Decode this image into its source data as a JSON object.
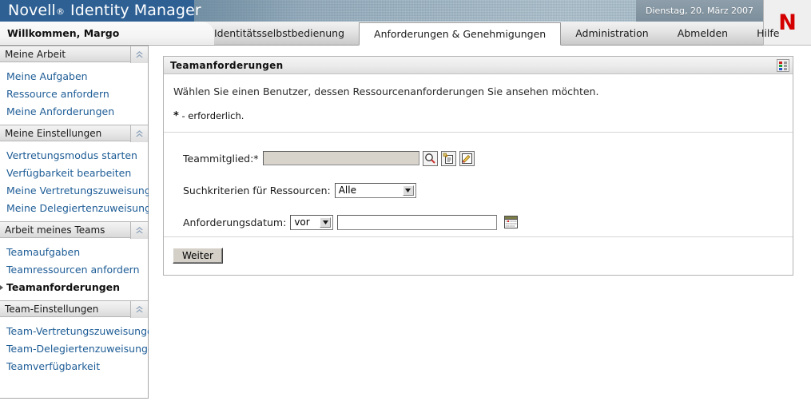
{
  "banner": {
    "brand_name": "Novell",
    "brand_reg": "®",
    "product_name": "Identity Manager",
    "date": "Dienstag, 20. März 2007",
    "logo_letter": "N",
    "logo_color": "#d40000",
    "bar_color": "#2e6094"
  },
  "welcome": {
    "text": "Willkommen, Margo"
  },
  "tabs": [
    {
      "label": "Identitätsselbstbedienung",
      "active": false
    },
    {
      "label": "Anforderungen & Genehmigungen",
      "active": true
    },
    {
      "label": "Administration",
      "active": false
    },
    {
      "label": "Abmelden",
      "active": false
    },
    {
      "label": "Hilfe",
      "active": false
    }
  ],
  "sidebar": {
    "sections": [
      {
        "title": "Meine Arbeit",
        "items": [
          {
            "label": "Meine Aufgaben",
            "current": false
          },
          {
            "label": "Ressource anfordern",
            "current": false
          },
          {
            "label": "Meine Anforderungen",
            "current": false
          }
        ]
      },
      {
        "title": "Meine Einstellungen",
        "items": [
          {
            "label": "Vertretungsmodus starten",
            "current": false
          },
          {
            "label": "Verfügbarkeit bearbeiten",
            "current": false
          },
          {
            "label": "Meine Vertretungszuweisungen",
            "current": false
          },
          {
            "label": "Meine Delegiertenzuweisungen",
            "current": false
          }
        ]
      },
      {
        "title": "Arbeit meines Teams",
        "items": [
          {
            "label": "Teamaufgaben",
            "current": false
          },
          {
            "label": "Teamressourcen anfordern",
            "current": false
          },
          {
            "label": "Teamanforderungen",
            "current": true
          }
        ]
      },
      {
        "title": "Team-Einstellungen",
        "items": [
          {
            "label": "Team-Vertretungszuweisungen",
            "current": false
          },
          {
            "label": "Team-Delegiertenzuweisungen",
            "current": false
          },
          {
            "label": "Teamverfügbarkeit",
            "current": false
          }
        ]
      }
    ]
  },
  "portlet": {
    "title": "Teamanforderungen",
    "tool_icon": "grid-options-icon",
    "intro_text": "Wählen Sie einen Benutzer, dessen Ressourcenanforderungen Sie ansehen möchten.",
    "required_marker": "*",
    "required_note": "- erforderlich."
  },
  "form": {
    "team_member": {
      "label": "Teammitglied:*",
      "value": "",
      "placeholder": "",
      "buttons": [
        {
          "name": "object-lookup-icon",
          "title": "Suchen"
        },
        {
          "name": "history-list-icon",
          "title": "Liste"
        },
        {
          "name": "edit-pencil-icon",
          "title": "Bearbeiten"
        }
      ]
    },
    "resource_criteria": {
      "label": "Suchkriterien für Ressourcen:",
      "value": "Alle",
      "options": [
        "Alle"
      ]
    },
    "request_date": {
      "label": "Anforderungsdatum:",
      "operator_value": "vor",
      "operator_options": [
        "vor"
      ],
      "date_value": "",
      "calendar_icon": "calendar-picker-icon"
    }
  },
  "actions": {
    "submit_label": "Weiter"
  }
}
